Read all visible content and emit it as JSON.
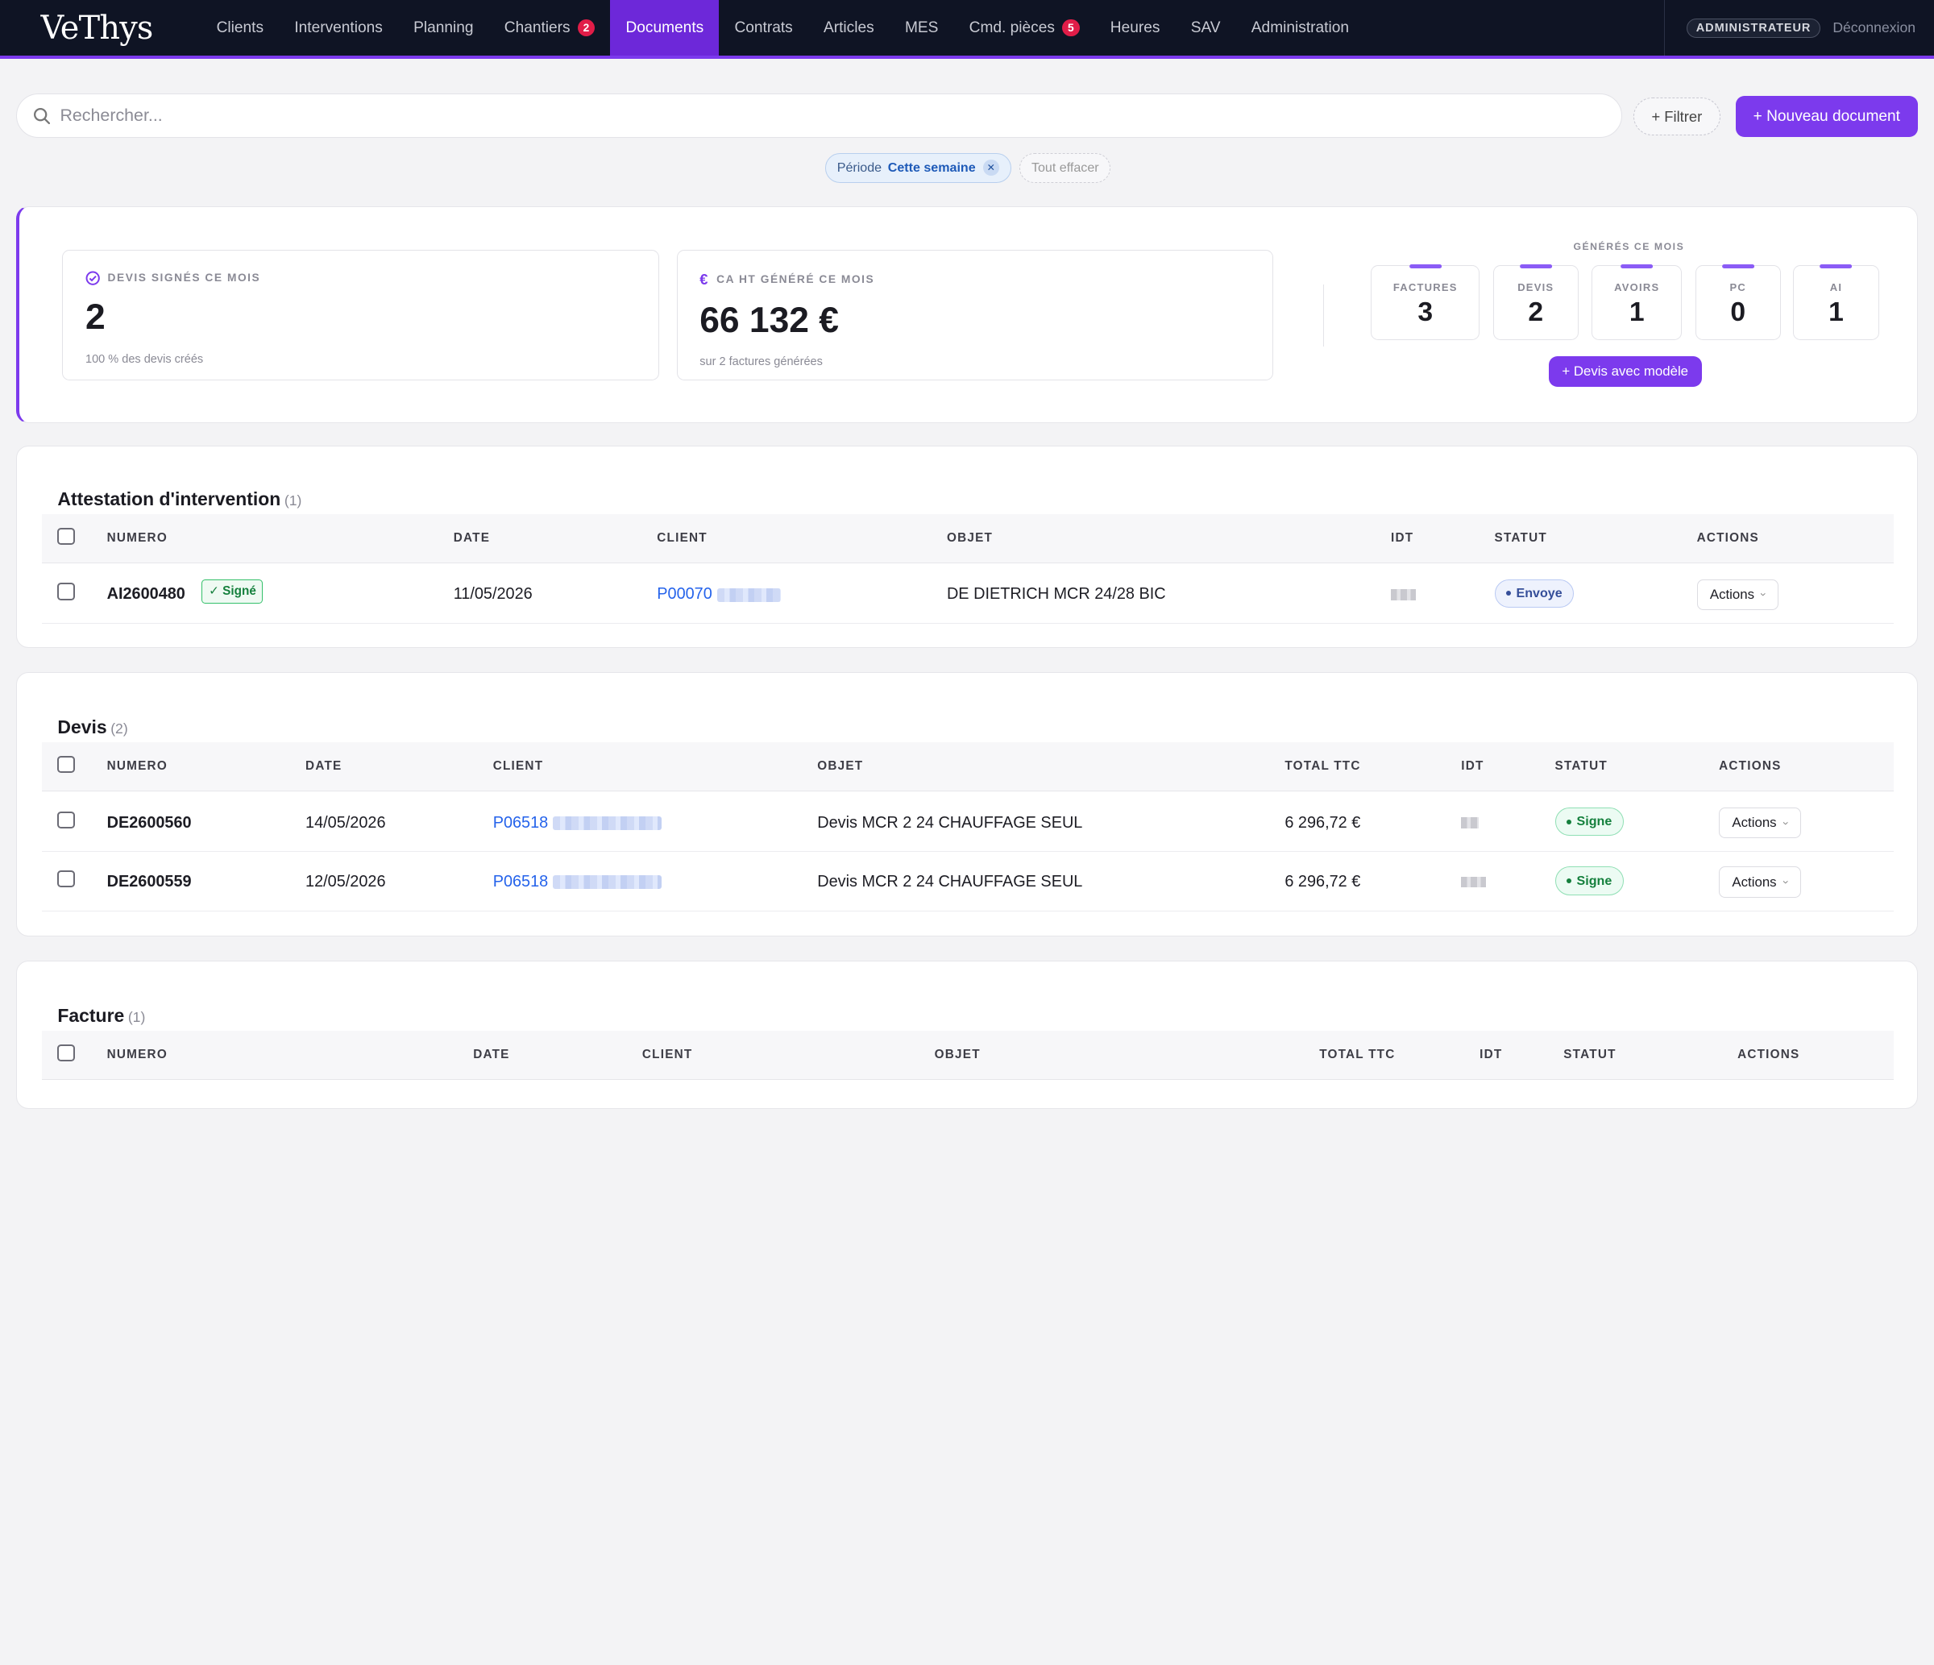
{
  "app": {
    "logo": "VeThys"
  },
  "nav": {
    "items": [
      {
        "label": "Clients",
        "badge": ""
      },
      {
        "label": "Interventions",
        "badge": ""
      },
      {
        "label": "Planning",
        "badge": ""
      },
      {
        "label": "Chantiers",
        "badge": "2"
      },
      {
        "label": "Documents",
        "badge": "",
        "active": true
      },
      {
        "label": "Contrats",
        "badge": ""
      },
      {
        "label": "Articles",
        "badge": ""
      },
      {
        "label": "MES",
        "badge": ""
      },
      {
        "label": "Cmd. pièces",
        "badge": "5"
      },
      {
        "label": "Heures",
        "badge": ""
      },
      {
        "label": "SAV",
        "badge": ""
      },
      {
        "label": "Administration",
        "badge": ""
      }
    ],
    "role": "ADMINISTRATEUR",
    "logout": "Déconnexion"
  },
  "search": {
    "placeholder": "Rechercher...",
    "value": ""
  },
  "toolbar": {
    "filter_label": "+ Filtrer",
    "new_label": "+ Nouveau document"
  },
  "chips": {
    "period_key": "Période",
    "period_value": "Cette semaine",
    "clear_label": "Tout effacer"
  },
  "stats": {
    "devis": {
      "label": "DEVIS SIGNÉS CE MOIS",
      "value": "2",
      "sub": "100 % des devis créés"
    },
    "ca": {
      "label": "CA HT GÉNÉRÉ CE MOIS",
      "value": "66 132 €",
      "sub": "sur 2 factures générées"
    },
    "generated_title": "GÉNÉRÉS CE MOIS",
    "generated": [
      {
        "label": "FACTURES",
        "value": "3"
      },
      {
        "label": "DEVIS",
        "value": "2"
      },
      {
        "label": "AVOIRS",
        "value": "1"
      },
      {
        "label": "PC",
        "value": "0"
      },
      {
        "label": "AI",
        "value": "1"
      }
    ],
    "model_button": "+ Devis avec modèle"
  },
  "sections": {
    "attestation": {
      "title": "Attestation d'intervention",
      "count": "(1)",
      "headers": [
        "NUMERO",
        "DATE",
        "CLIENT",
        "OBJET",
        "IDT",
        "STATUT",
        "ACTIONS"
      ],
      "rows": [
        {
          "numero": "AI2600480",
          "tag": "✓ Signé",
          "date": "11/05/2026",
          "client": "P00070",
          "objet": "DE DIETRICH MCR 24/28 BIC",
          "statut": "Envoye",
          "actions": "Actions"
        }
      ]
    },
    "devis": {
      "title": "Devis",
      "count": "(2)",
      "headers": [
        "NUMERO",
        "DATE",
        "CLIENT",
        "OBJET",
        "TOTAL TTC",
        "IDT",
        "STATUT",
        "ACTIONS"
      ],
      "rows": [
        {
          "numero": "DE2600560",
          "date": "14/05/2026",
          "client": "P06518",
          "objet": "Devis MCR 2 24 CHAUFFAGE SEUL",
          "total": "6 296,72 €",
          "statut": "Signe",
          "actions": "Actions"
        },
        {
          "numero": "DE2600559",
          "date": "12/05/2026",
          "client": "P06518",
          "objet": "Devis MCR 2 24 CHAUFFAGE SEUL",
          "total": "6 296,72 €",
          "statut": "Signe",
          "actions": "Actions"
        }
      ]
    },
    "facture": {
      "title": "Facture",
      "count": "(1)",
      "headers": [
        "NUMERO",
        "DATE",
        "CLIENT",
        "OBJET",
        "TOTAL TTC",
        "IDT",
        "STATUT",
        "ACTIONS"
      ]
    }
  },
  "colors": {
    "accent": "#7c3aed",
    "topbar": "#0f1424",
    "link": "#2563eb",
    "badge": "#e11d48"
  },
  "icons": {
    "search": "search-icon",
    "devis_stat": "check-circle-icon",
    "ca_stat": "euro-icon"
  }
}
